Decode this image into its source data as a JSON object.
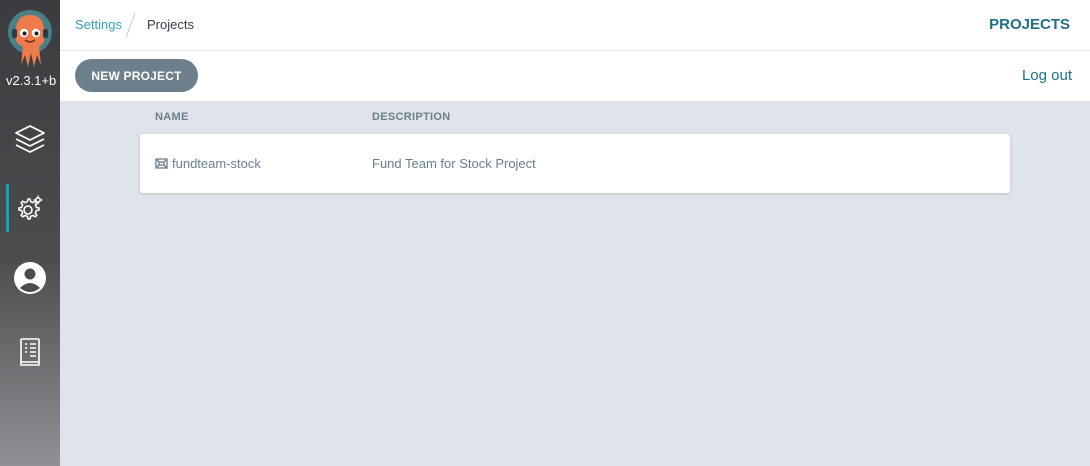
{
  "sidebar": {
    "version": "v2.3.1+b",
    "items": [
      {
        "name": "applications",
        "icon": "layers-icon"
      },
      {
        "name": "settings",
        "icon": "gear-icon",
        "active": true
      },
      {
        "name": "user-info",
        "icon": "user-icon"
      },
      {
        "name": "documentation",
        "icon": "book-icon"
      }
    ]
  },
  "breadcrumb": {
    "parent": "Settings",
    "current": "Projects"
  },
  "header": {
    "title": "PROJECTS"
  },
  "toolbar": {
    "new_project_label": "NEW PROJECT",
    "logout_label": "Log out"
  },
  "table": {
    "columns": [
      "NAME",
      "DESCRIPTION"
    ],
    "rows": [
      {
        "name": "fundteam-stock",
        "description": "Fund Team for Stock Project",
        "icon": "project-icon"
      }
    ]
  },
  "colors": {
    "accent": "#1f6f87",
    "link": "#3aa0bf",
    "active_indicator": "#18a2b8",
    "button_bg": "#6d7f8b",
    "background": "#dee4ea"
  }
}
